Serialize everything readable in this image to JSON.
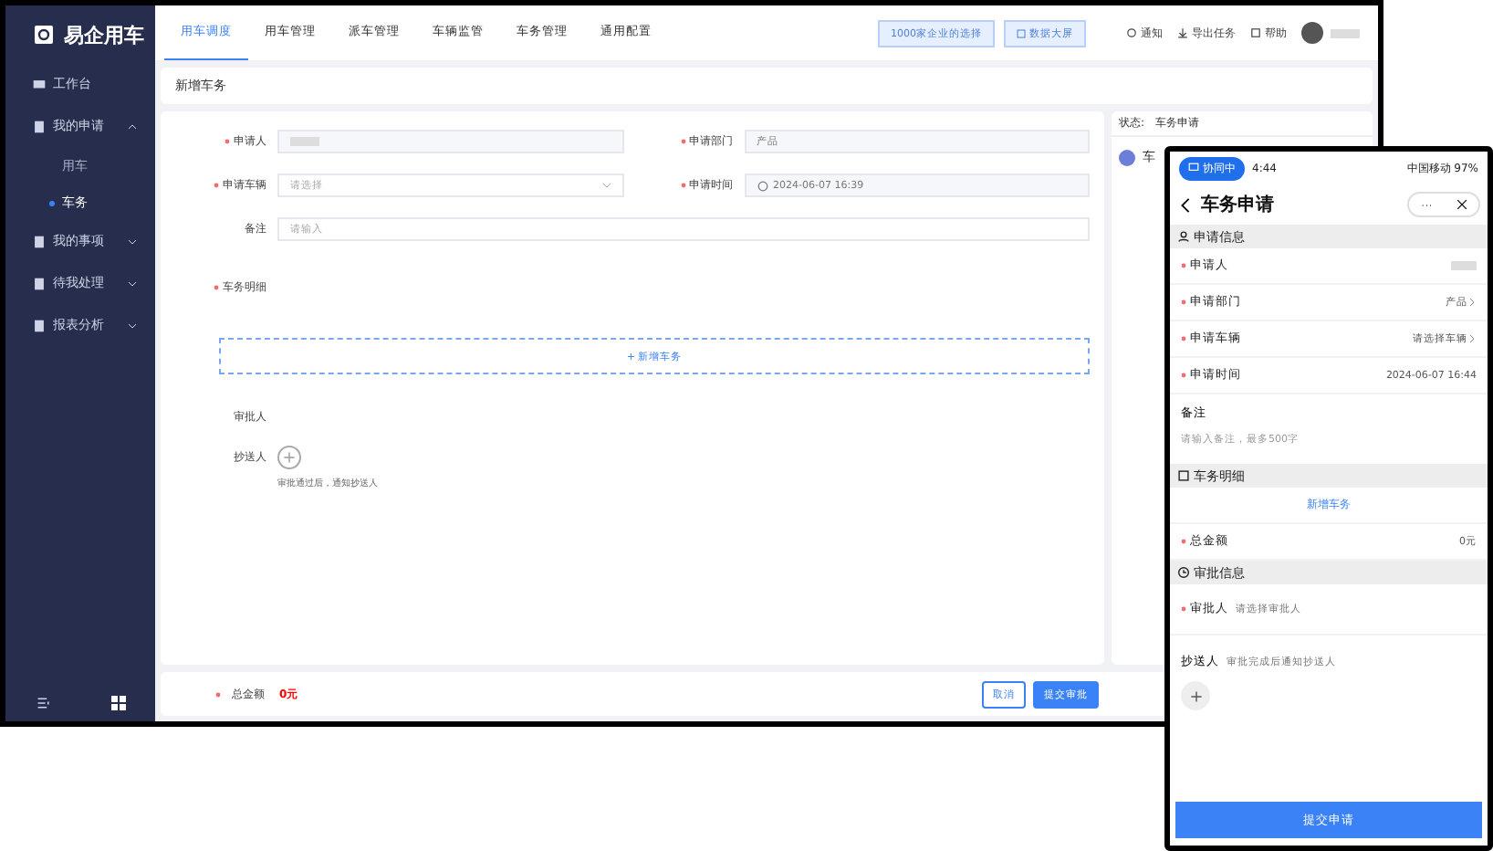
{
  "app": {
    "logo": "易企用车"
  },
  "sidebar": {
    "items": [
      {
        "label": "工作台"
      },
      {
        "label": "我的申请",
        "expanded": true,
        "children": [
          {
            "label": "用车",
            "selected": false
          },
          {
            "label": "车务",
            "selected": true
          }
        ]
      },
      {
        "label": "我的事项",
        "expanded": false
      },
      {
        "label": "待我处理",
        "expanded": false
      },
      {
        "label": "报表分析",
        "expanded": false
      }
    ]
  },
  "tabs": [
    {
      "label": "用车调度",
      "selected": true
    },
    {
      "label": "用车管理",
      "selected": false
    },
    {
      "label": "派车管理",
      "selected": false
    },
    {
      "label": "车辆监管",
      "selected": false
    },
    {
      "label": "车务管理",
      "selected": false
    },
    {
      "label": "通用配置",
      "selected": false
    }
  ],
  "header_buttons": [
    "1000家企业的选择",
    "数据大屏"
  ],
  "header_links": [
    "通知",
    "导出任务",
    "帮助"
  ],
  "breadcrumb": "新增车务",
  "form": {
    "fields": [
      {
        "label": "申请人",
        "required": true,
        "kind": "readonly"
      },
      {
        "label": "申请部门",
        "required": true,
        "kind": "readonly",
        "value": "产品"
      },
      {
        "label": "申请车辆",
        "required": true,
        "kind": "select",
        "placeholder": "请选择"
      },
      {
        "label": "申请时间",
        "required": true,
        "kind": "date",
        "value": "2024-06-07 16:39"
      },
      {
        "label": "备注",
        "required": false,
        "kind": "textarea",
        "placeholder": "请输入"
      }
    ],
    "detail_label": "车务明细",
    "add_button": "+ 新增车务",
    "approver_label": "审批人",
    "cc_label": "抄送人",
    "cc_hint": "审批通过后，通知抄送人"
  },
  "footer": {
    "total_label": "总金额",
    "total_value": "0元",
    "buttons": [
      {
        "label": "取消",
        "kind": "secondary"
      },
      {
        "label": "提交审批",
        "kind": "primary"
      }
    ]
  },
  "status_panel": {
    "status_label": "状态:",
    "status_value": "车务申请",
    "step_title": "车"
  },
  "phone": {
    "status_pill": "协同中",
    "time": "4:44",
    "status_right": "中国移动 97%",
    "title": "车务申请",
    "sections": [
      {
        "title": "申请信息",
        "rows": [
          {
            "kind": "row",
            "label": "申请人",
            "required": true,
            "chevron": false
          },
          {
            "kind": "row",
            "label": "申请部门",
            "required": true,
            "value": "产品",
            "chevron": true
          },
          {
            "kind": "row",
            "label": "申请车辆",
            "required": true,
            "value": "请选择车辆",
            "chevron": true
          },
          {
            "kind": "row",
            "label": "申请时间",
            "required": true,
            "value": "2024-06-07 16:44",
            "chevron": false
          },
          {
            "kind": "note",
            "label": "备注",
            "placeholder": "请输入备注，最多500字"
          }
        ]
      },
      {
        "title": "车务明细",
        "rows": [
          {
            "kind": "link",
            "label": "新增车务"
          },
          {
            "kind": "row",
            "label": "总金额",
            "required": true,
            "value": "0元",
            "chevron": false
          }
        ]
      },
      {
        "title": "审批信息",
        "rows": [
          {
            "kind": "person",
            "label": "审批人",
            "required": true,
            "hint": "请选择审批人"
          },
          {
            "kind": "cc",
            "label": "抄送人",
            "required": false,
            "hint": "审批完成后通知抄送人"
          }
        ]
      }
    ],
    "submit": "提交申请"
  }
}
